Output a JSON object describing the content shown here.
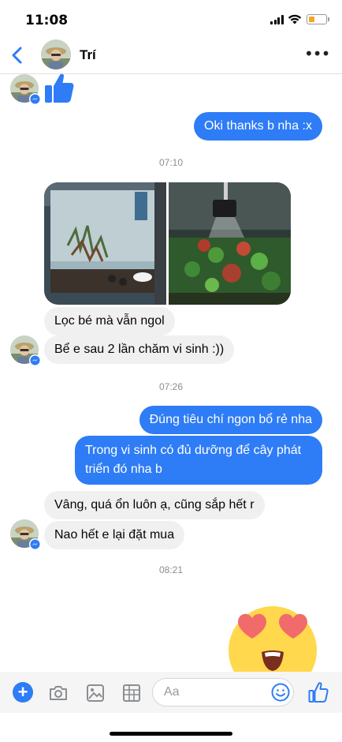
{
  "status_bar": {
    "time": "11:08",
    "battery_color": "#f5a623"
  },
  "header": {
    "contact_name": "Trí",
    "back_icon": "chevron-left-icon",
    "more_icon": "more-horizontal-icon",
    "more_label": "•••"
  },
  "accent_color": "#2e7cf6",
  "messages": {
    "m1": "Oki thanks b nha :x",
    "t1": "07:10",
    "m2": "Lọc bé mà vẫn ngol",
    "m3": "Bể e sau 2 lần chăm vi sinh :))",
    "t2": "07:26",
    "m4": "Đúng tiêu chí ngon bổ rẻ nha",
    "m5": "Trong vi sinh có đủ dưỡng để cây phát triển đó nha b",
    "m6": "Vâng, quá ổn luôn ạ, cũng sắp hết r",
    "m7": "Nao hết e lại đặt mua",
    "t3": "08:21"
  },
  "composer": {
    "placeholder": "Aa",
    "plus_label": "+",
    "icons": [
      "plus-icon",
      "camera-icon",
      "photo-icon",
      "sticker-icon",
      "emoji-icon",
      "like-icon"
    ]
  }
}
